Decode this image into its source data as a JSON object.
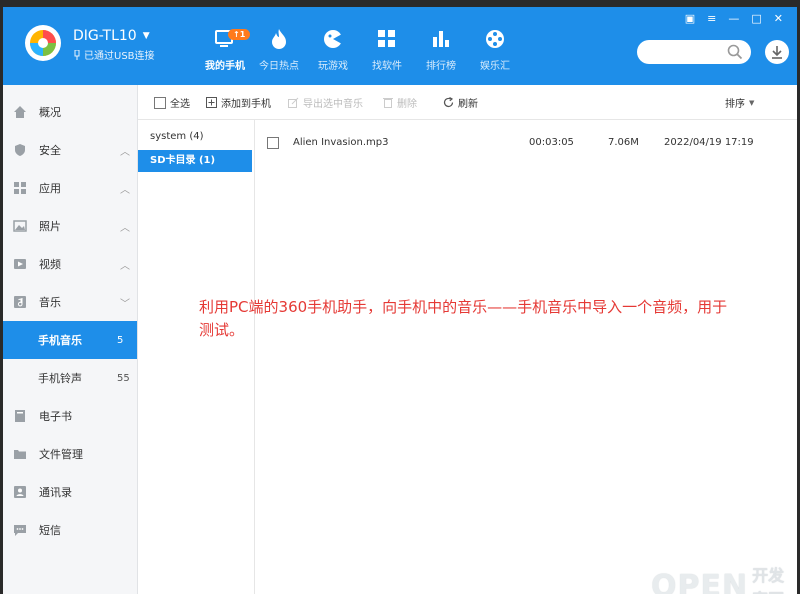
{
  "header": {
    "device_name": "DIG-TL10",
    "usb_status": "已通过USB连接",
    "nav": [
      {
        "label": "我的手机",
        "icon": "phone-icon",
        "badge": "1",
        "active": true
      },
      {
        "label": "今日热点",
        "icon": "fire-icon"
      },
      {
        "label": "玩游戏",
        "icon": "gamepad-icon"
      },
      {
        "label": "找软件",
        "icon": "apps-grid-icon"
      },
      {
        "label": "排行榜",
        "icon": "bar-chart-icon"
      },
      {
        "label": "娱乐汇",
        "icon": "film-reel-icon"
      }
    ],
    "search_placeholder": ""
  },
  "sidebar": {
    "items": [
      {
        "label": "概况",
        "icon": "home-icon"
      },
      {
        "label": "安全",
        "icon": "shield-icon",
        "chevron": "up"
      },
      {
        "label": "应用",
        "icon": "apps-icon",
        "chevron": "up"
      },
      {
        "label": "照片",
        "icon": "photo-icon",
        "chevron": "up"
      },
      {
        "label": "视频",
        "icon": "video-icon",
        "chevron": "up"
      },
      {
        "label": "音乐",
        "icon": "music-icon",
        "chevron": "down"
      },
      {
        "label": "手机音乐",
        "count": "5",
        "active": true
      },
      {
        "label": "手机铃声",
        "count": "55"
      },
      {
        "label": "电子书",
        "icon": "book-icon"
      },
      {
        "label": "文件管理",
        "icon": "folder-icon"
      },
      {
        "label": "通讯录",
        "icon": "contacts-icon"
      },
      {
        "label": "短信",
        "icon": "message-icon"
      }
    ]
  },
  "toolbar": {
    "select_all": "全选",
    "add_to_phone": "添加到手机",
    "export_music": "导出选中音乐",
    "delete": "删除",
    "refresh": "刷新",
    "sort": "排序"
  },
  "folders": [
    {
      "label": "system (4)"
    },
    {
      "label": "SD卡目录 (1)",
      "active": true
    }
  ],
  "files": [
    {
      "name": "Alien Invasion.mp3",
      "duration": "00:03:05",
      "size": "7.06M",
      "date": "2022/04/19 17:19"
    }
  ],
  "annotation": "利用PC端的360手机助手，向手机中的音乐——手机音乐中导入一个音频，用于测试。",
  "watermark": {
    "brand": "OPEN",
    "sub": "开发家园"
  },
  "colors": {
    "accent": "#1e8ee9",
    "badge": "#ff7a1c",
    "annotation": "#e53935"
  }
}
